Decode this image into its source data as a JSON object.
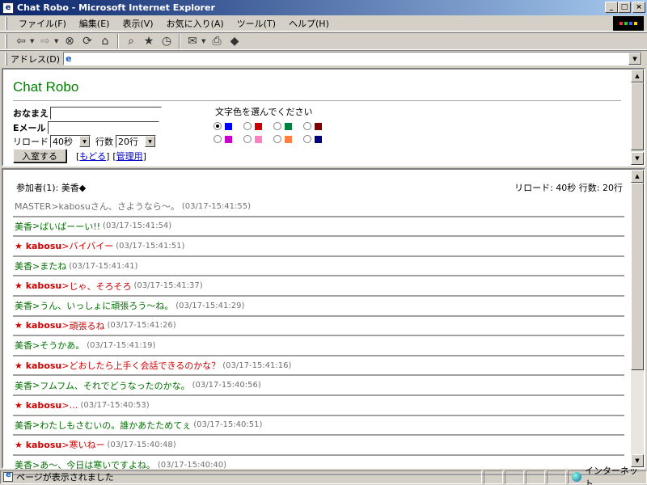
{
  "window": {
    "title": "Chat Robo - Microsoft Internet Explorer"
  },
  "menu": [
    "ファイル(F)",
    "編集(E)",
    "表示(V)",
    "お気に入り(A)",
    "ツール(T)",
    "ヘルプ(H)"
  ],
  "address": {
    "label": "アドレス(D)",
    "value": ""
  },
  "form": {
    "brand": "Chat Robo",
    "name_label": "おなまえ",
    "email_label": "Eメール",
    "reload_label": "リロード",
    "reload_value": "40秒",
    "rows_label": "行数",
    "rows_value": "20行",
    "enter_button": "入室する",
    "back_link": "もどる",
    "admin_link": "管理用",
    "color_title": "文字色を選んでください",
    "colors_row1": [
      "#0000ff",
      "#cc0000",
      "#008040",
      "#800000"
    ],
    "colors_row2": [
      "#cc00cc",
      "#ff80c0",
      "#ff8040",
      "#000080"
    ],
    "selected_color_index": 0
  },
  "chat": {
    "participants_label": "参加者(1): 美香◆",
    "settings_label": "リロード: 40秒 行数: 20行",
    "messages": [
      {
        "speaker": "MASTER",
        "text": "kabosuさん、さようなら～。",
        "time": "(03/17-15:41:55)",
        "color": "gray"
      },
      {
        "speaker": "美香",
        "text": "ばいばーーい!!",
        "time": "(03/17-15:41:54)",
        "color": "green"
      },
      {
        "speaker": "★ kabosu",
        "text": "バイバイー",
        "time": "(03/17-15:41:51)",
        "color": "red"
      },
      {
        "speaker": "美香",
        "text": "またね",
        "time": "(03/17-15:41:41)",
        "color": "green"
      },
      {
        "speaker": "★ kabosu",
        "text": "じゃ、そろそろ",
        "time": "(03/17-15:41:37)",
        "color": "red"
      },
      {
        "speaker": "美香",
        "text": "うん、いっしょに頑張ろう～ね。",
        "time": "(03/17-15:41:29)",
        "color": "green"
      },
      {
        "speaker": "★ kabosu",
        "text": "頑張るね",
        "time": "(03/17-15:41:26)",
        "color": "red"
      },
      {
        "speaker": "美香",
        "text": "そうかあ。",
        "time": "(03/17-15:41:19)",
        "color": "green"
      },
      {
        "speaker": "★ kabosu",
        "text": "どおしたら上手く会話できるのかな？",
        "time": "(03/17-15:41:16)",
        "color": "red"
      },
      {
        "speaker": "美香",
        "text": "フムフム、それでどうなったのかな。",
        "time": "(03/17-15:40:56)",
        "color": "green"
      },
      {
        "speaker": "★ kabosu",
        "text": "…",
        "time": "(03/17-15:40:53)",
        "color": "red"
      },
      {
        "speaker": "美香",
        "text": "わたしもさむいの。誰かあたためてぇ",
        "time": "(03/17-15:40:51)",
        "color": "green"
      },
      {
        "speaker": "★ kabosu",
        "text": "寒いねー",
        "time": "(03/17-15:40:48)",
        "color": "red"
      },
      {
        "speaker": "美香",
        "text": "あ～、今日は寒いですよね。",
        "time": "(03/17-15:40:40)",
        "color": "green"
      }
    ]
  },
  "status": {
    "text": "ページが表示されました",
    "zone": "インターネット"
  }
}
